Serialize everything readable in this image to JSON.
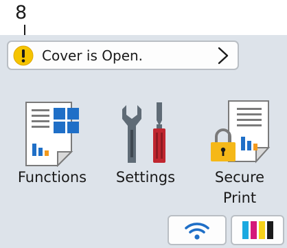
{
  "callout": {
    "number": "8"
  },
  "status": {
    "message": "Cover is Open.",
    "icon": "warning-icon",
    "chevron": "chevron-right-icon"
  },
  "apps": [
    {
      "label": "Functions",
      "icon": "functions-icon"
    },
    {
      "label": "Settings",
      "icon": "settings-icon"
    },
    {
      "label_line1": "Secure",
      "label_line2": "Print",
      "icon": "secure-print-icon"
    }
  ],
  "bottom": {
    "wifi_icon": "wifi-icon",
    "toner_icon": "toner-icon"
  },
  "colors": {
    "screen_bg": "#dde3ea",
    "warning": "#f5c400",
    "accent_blue": "#1f6fc7",
    "accent_orange": "#f39a1e",
    "tool_red": "#c0262f",
    "toner_cyan": "#1aa9e0",
    "toner_magenta": "#d4187a",
    "toner_yellow": "#f6d21a",
    "toner_black": "#1a1a1a"
  }
}
